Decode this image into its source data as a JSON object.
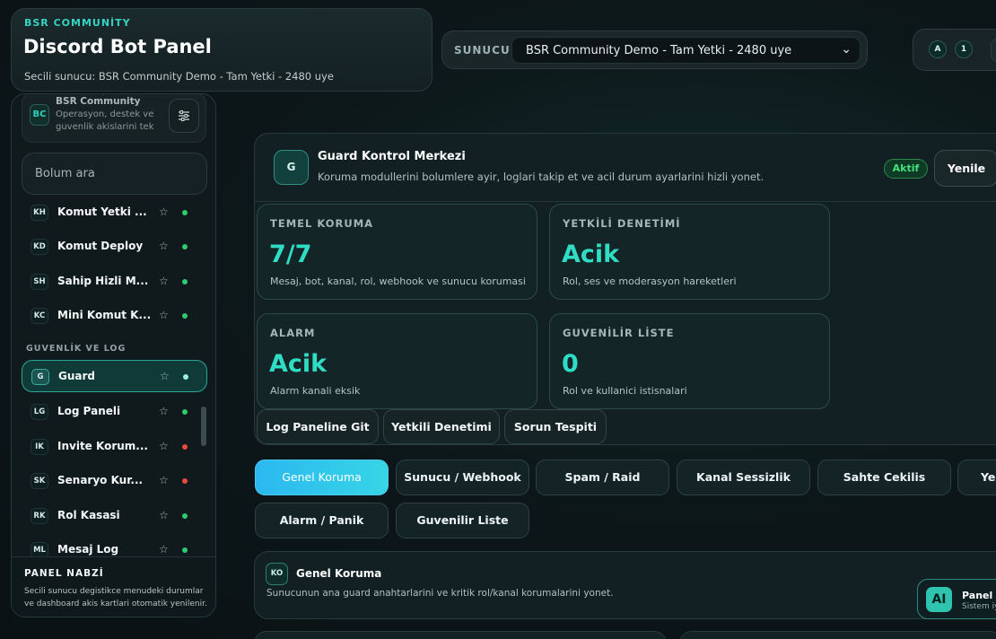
{
  "header": {
    "kicker": "BSR COMMUNİTY",
    "title": "Discord Bot Panel",
    "subtitle": "Secili sunucu: BSR Community Demo - Tam Yetki - 2480 uye",
    "server_label": "SUNUCU",
    "server_selected": "BSR Community Demo - Tam Yetki - 2480 uye",
    "badges": [
      "A",
      "1"
    ]
  },
  "sidebar": {
    "community": {
      "logo": "BC",
      "name": "BSR Community",
      "desc": "Operasyon, destek ve guvenlik akislarini tek",
      "filter_icon": "sliders-icon"
    },
    "search_placeholder": "Bolum ara",
    "items_top": [
      {
        "code": "KH",
        "label": "Komut Yetki ...",
        "status": "green"
      },
      {
        "code": "KD",
        "label": "Komut Deploy",
        "status": "green"
      },
      {
        "code": "SH",
        "label": "Sahip Hizli M...",
        "status": "green"
      },
      {
        "code": "KC",
        "label": "Mini Komut K...",
        "status": "green"
      }
    ],
    "section_label": "GUVENLİK VE LOG",
    "items_security": [
      {
        "code": "G",
        "label": "Guard",
        "status": "green",
        "active": true
      },
      {
        "code": "LG",
        "label": "Log Paneli",
        "status": "green"
      },
      {
        "code": "IK",
        "label": "Invite Korum...",
        "status": "red"
      },
      {
        "code": "SK",
        "label": "Senaryo Kur...",
        "status": "red"
      },
      {
        "code": "RK",
        "label": "Rol Kasasi",
        "status": "green"
      },
      {
        "code": "ML",
        "label": "Mesaj Log",
        "status": "green"
      }
    ],
    "star_icon": "☆",
    "pulse": {
      "title": "PANEL NABZİ",
      "desc": "Secili sunucu degistikce menudeki durumlar ve dashboard akis kartlari otomatik yenilenir."
    }
  },
  "guard": {
    "icon": "G",
    "title": "Guard Kontrol Merkezi",
    "subtitle": "Koruma modullerini bolumlere ayir, loglari takip et ve acil durum ayarlarini hizli yonet.",
    "status": "Aktif",
    "refresh_label": "Yenile",
    "stats": [
      {
        "label": "TEMEL KORUMA",
        "value": "7/7",
        "desc": "Mesaj, bot, kanal, rol, webhook ve sunucu korumasi"
      },
      {
        "label": "YETKİLİ DENETİMİ",
        "value": "Acik",
        "desc": "Rol, ses ve moderasyon hareketleri"
      },
      {
        "label": "ALARM",
        "value": "Acik",
        "desc": "Alarm kanali eksik"
      },
      {
        "label": "GUVENİLİR LİSTE",
        "value": "0",
        "desc": "Rol ve kullanici istisnalari"
      }
    ],
    "quick_actions": [
      "Log Paneline Git",
      "Yetkili Denetimi",
      "Sorun Tespiti"
    ]
  },
  "tabs": {
    "row1": [
      "Genel Koruma",
      "Sunucu / Webhook",
      "Spam / Raid",
      "Kanal Sessizlik",
      "Sahte Cekilis",
      "Ye"
    ],
    "row2": [
      "Alarm / Panik",
      "Guvenilir Liste"
    ],
    "active": "Genel Koruma"
  },
  "section": {
    "icon": "KO",
    "title": "Genel Koruma",
    "subtitle": "Sunucunun ana guard anahtarlarini ve kritik rol/kanal korumalarini yonet."
  },
  "ai": {
    "icon": "AI",
    "title": "Panel Asistani",
    "subtitle": "Sistem iyi"
  },
  "colors": {
    "accent": "#2fdcc4",
    "status_green": "#2ecc71",
    "status_red": "#e74c3c",
    "tab_active": "#2bb8f0"
  }
}
